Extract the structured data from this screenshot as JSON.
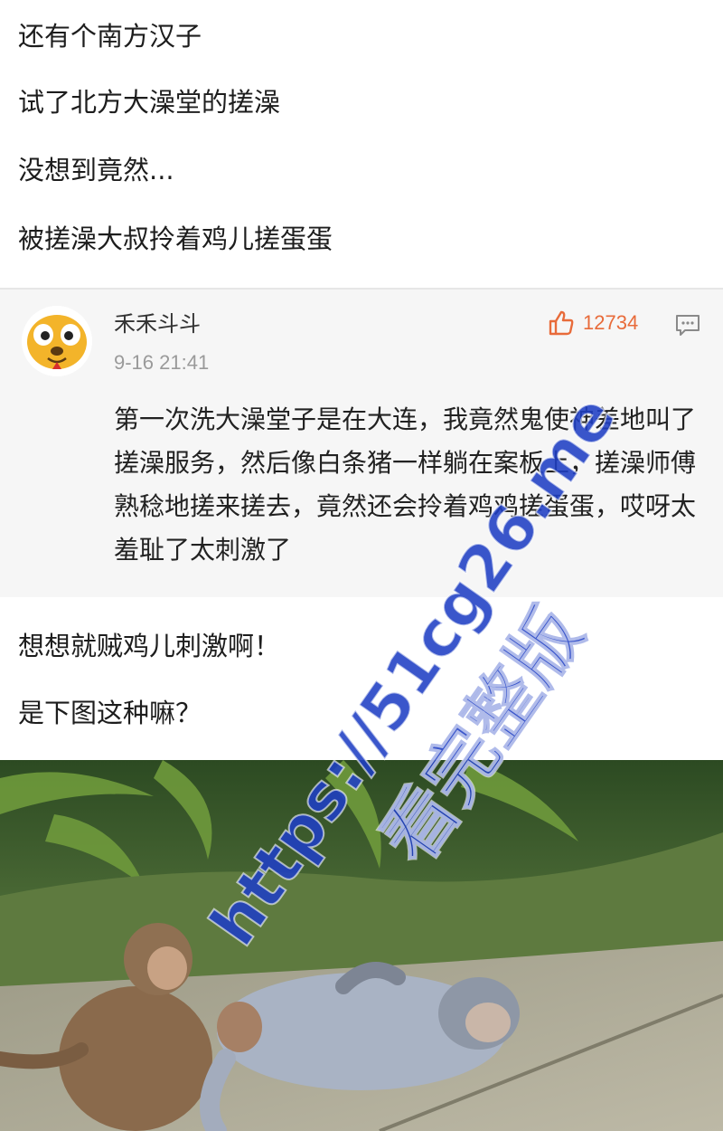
{
  "post": {
    "lines": [
      "还有个南方汉子",
      "试了北方大澡堂的搓澡",
      "没想到竟然...",
      "被搓澡大叔拎着鸡儿搓蛋蛋"
    ],
    "after_lines": [
      "想想就贼鸡儿刺激啊！",
      "是下图这种嘛？"
    ]
  },
  "comment": {
    "username": "禾禾斗斗",
    "timestamp": "9-16 21:41",
    "likes": "12734",
    "text": "第一次洗大澡堂子是在大连，我竟然鬼使神差地叫了搓澡服务，然后像白条猪一样躺在案板上，搓澡师傅熟稔地搓来搓去，竟然还会拎着鸡鸡搓蛋蛋，哎呀太羞耻了太刺激了",
    "avatar_icon": "cartoon-dog-avatar",
    "like_icon": "thumbs-up-icon",
    "reply_icon": "comment-icon"
  },
  "watermark": {
    "url": "https://51cg26.me",
    "label": "看完整版",
    "color": "#1f3fc4"
  },
  "colors": {
    "like": "#e86b3a",
    "card_bg": "#f6f6f6"
  }
}
